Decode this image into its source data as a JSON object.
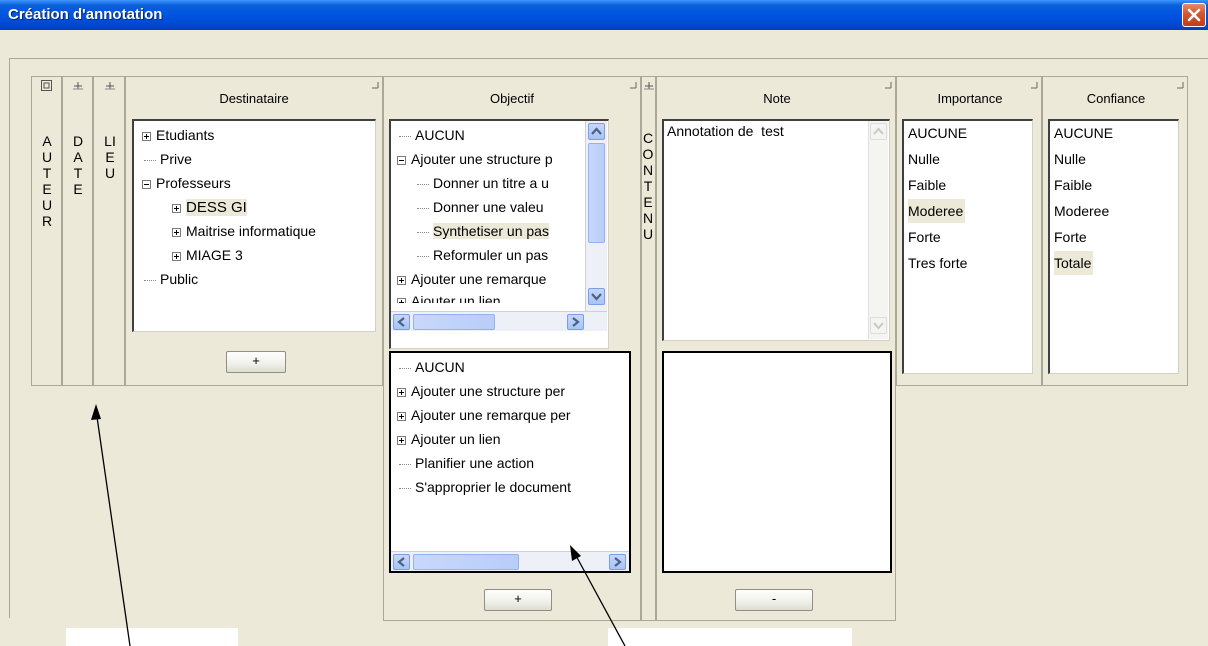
{
  "window": {
    "title": "Création d'annotation"
  },
  "icons": {
    "close": "close-icon",
    "pin": "pin-icon",
    "expand": "expand-icon"
  },
  "columns": {
    "auteur": {
      "label": "AUTEUR"
    },
    "date": {
      "label": "DATE"
    },
    "lieu": {
      "label": "LIEU"
    },
    "contenu": {
      "label": "CONTENU"
    },
    "destinataire": {
      "header": "Destinataire",
      "items": [
        "Etudiants",
        "Prive",
        "Professeurs",
        "DESS GI",
        "Maitrise informatique",
        "MIAGE 3",
        "Public"
      ],
      "add_label": "+"
    },
    "objectif": {
      "header": "Objectif",
      "items": [
        "AUCUN",
        "Ajouter une structure p",
        "Donner un titre a u",
        "Donner une valeu",
        "Synthetiser un pas",
        "Reformuler un pas",
        "Ajouter une remarque",
        "Ajouter un lien"
      ],
      "items2": [
        "AUCUN",
        "Ajouter une structure per",
        "Ajouter une remarque per",
        "Ajouter un lien",
        "Planifier une action",
        "S'approprier le document"
      ],
      "add_label": "+"
    },
    "note": {
      "header": "Note",
      "text": "Annotation de  test",
      "remove_label": "-"
    },
    "importance": {
      "header": "Importance",
      "items": [
        "AUCUNE",
        "Nulle",
        "Faible",
        "Moderee",
        "Forte",
        "Tres forte"
      ],
      "selected": "Moderee"
    },
    "confiance": {
      "header": "Confiance",
      "items": [
        "AUCUNE",
        "Nulle",
        "Faible",
        "Moderee",
        "Forte",
        "Totale"
      ],
      "selected": "Totale"
    }
  }
}
